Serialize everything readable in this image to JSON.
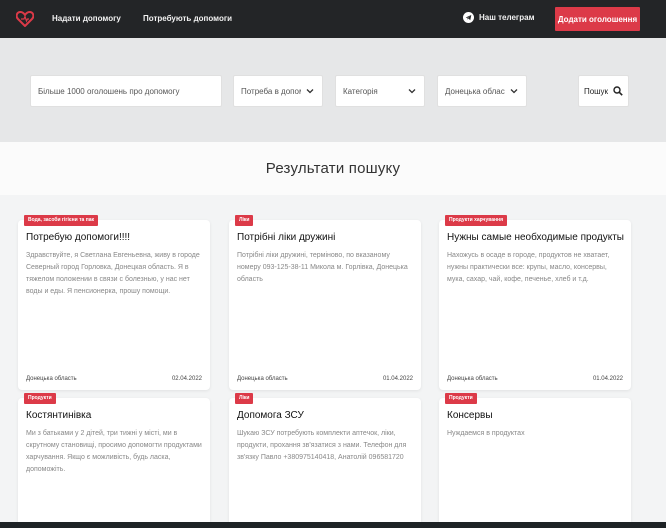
{
  "colors": {
    "accent": "#dc3a48",
    "navbar": "#232527"
  },
  "nav": {
    "links": [
      "Надати допомогу",
      "Потребують допомоги"
    ],
    "telegram_label": "Наш телеграм",
    "add_button": "Додати оголошення"
  },
  "search": {
    "query_placeholder": "Більше 1000 оголошень про допомогу",
    "type_select": "Потреба в допом",
    "category_select": "Категорія",
    "region_select": "Донецька область",
    "button_label": "Пошук"
  },
  "results": {
    "title": "Результати пошуку",
    "cards": [
      {
        "badge": "Вода, засоби гігієни та пак",
        "title": "Потребую допомоги!!!!",
        "description": "Здравствуйте, я Светлана Евгеньевна, живу в городе Северный город Горловка, Донецкая область. Я в тяжелом положении в связи с болезнью, у нас нет воды и еды. Я пенсионерка, прошу помощи.",
        "location": "Донецька область",
        "date": "02.04.2022"
      },
      {
        "badge": "Ліки",
        "title": "Потрібні ліки дружині",
        "description": "Потрібні ліки дружині, терміново, по вказаному номеру 093-125-38-11 Микола м. Горлівка, Донецька область",
        "location": "Донецька область",
        "date": "01.04.2022"
      },
      {
        "badge": "Продукти харчування",
        "title": "Нужны самые необходимые продукты",
        "description": "Нахожусь в осаде в городе, продуктов не хватает, нужны практически все: крупы, масло, консервы, мука, сахар, чай, кофе, печенье, хлеб и т.д.",
        "location": "Донецька область",
        "date": "01.04.2022"
      },
      {
        "badge": "Продукти",
        "title": "Костянтинівка",
        "description": "Ми з батьками у 2 дітей, три тижні у місті, ми в скрутному становищі, просимо допомогти продуктами харчування. Якщо є можливість, будь ласка, допоможіть.",
        "location": "",
        "date": ""
      },
      {
        "badge": "Ліки",
        "title": "Допомога ЗСУ",
        "description": "Шукаю ЗСУ потребують комплекти аптечок, ліки, продукти, прохання зв'язатися з нами. Телефон для зв'язку Павло +380975140418, Анатолій 096581720",
        "location": "",
        "date": ""
      },
      {
        "badge": "Продукти",
        "title": "Консервы",
        "description": "Нуждаемся в продуктах",
        "location": "",
        "date": ""
      }
    ]
  }
}
